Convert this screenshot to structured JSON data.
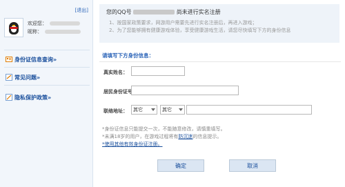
{
  "sidebar": {
    "logout_label": "[退出]",
    "welcome_label": "欢迎您：",
    "nickname_label": "昵称：",
    "links": [
      {
        "icon": "id-card-icon",
        "label": "身份证信息查询»"
      },
      {
        "icon": "help-icon",
        "label": "常见问题»"
      },
      {
        "icon": "privacy-icon",
        "label": "隐私保护政策»"
      }
    ]
  },
  "notice": {
    "title_prefix": "您的QQ号",
    "title_suffix": "尚未进行实名注册",
    "notes": [
      "1、按国家政策要求，网游用户需要先进行实名注册后，再进入游戏；",
      "2、为了您能够拥有健康游戏体验，享受健康游戏生活，请您尽快填写下方的身份信息"
    ]
  },
  "form": {
    "section_title": "请填写下方身份信息：",
    "real_name_label": "真实姓名：",
    "real_name_value": "",
    "id_label": "居民身份证号码：",
    "id_value": "",
    "address_label": "联络地址：",
    "province_select": "其它",
    "city_select": "其它",
    "address_value": ""
  },
  "help": {
    "line1": "*身份证信息只能提交一次，不能随意修改，请慎重填写。",
    "line2_prefix": "*未满18岁的用户，在游戏过程将有",
    "line2_link": "防沉迷",
    "line2_suffix": "的信息提示。",
    "line3": "*使用其他有效身份证注册。"
  },
  "buttons": {
    "ok": "确定",
    "cancel": "取消"
  },
  "colors": {
    "accent_blue": "#2b64b8",
    "sidebar_bg": "#f2f6fb",
    "notice_bg": "#eef3f9",
    "link_arrow": "#e07b00"
  }
}
